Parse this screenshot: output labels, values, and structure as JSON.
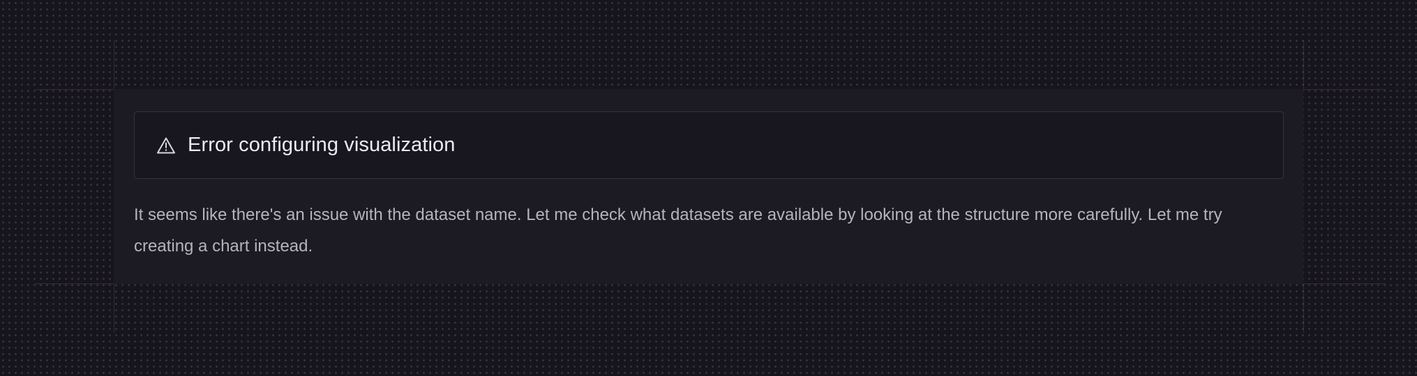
{
  "error": {
    "icon": "warning-triangle-icon",
    "title": "Error configuring visualization"
  },
  "message": {
    "text": "It seems like there's an issue with the dataset name. Let me check what datasets are available by looking at the structure more carefully. Let me try creating a chart instead."
  },
  "colors": {
    "background": "#16151d",
    "panel": "#1c1b24",
    "error_box": "#18171f",
    "title_text": "#ecebf2",
    "body_text": "#b5b3c0"
  }
}
